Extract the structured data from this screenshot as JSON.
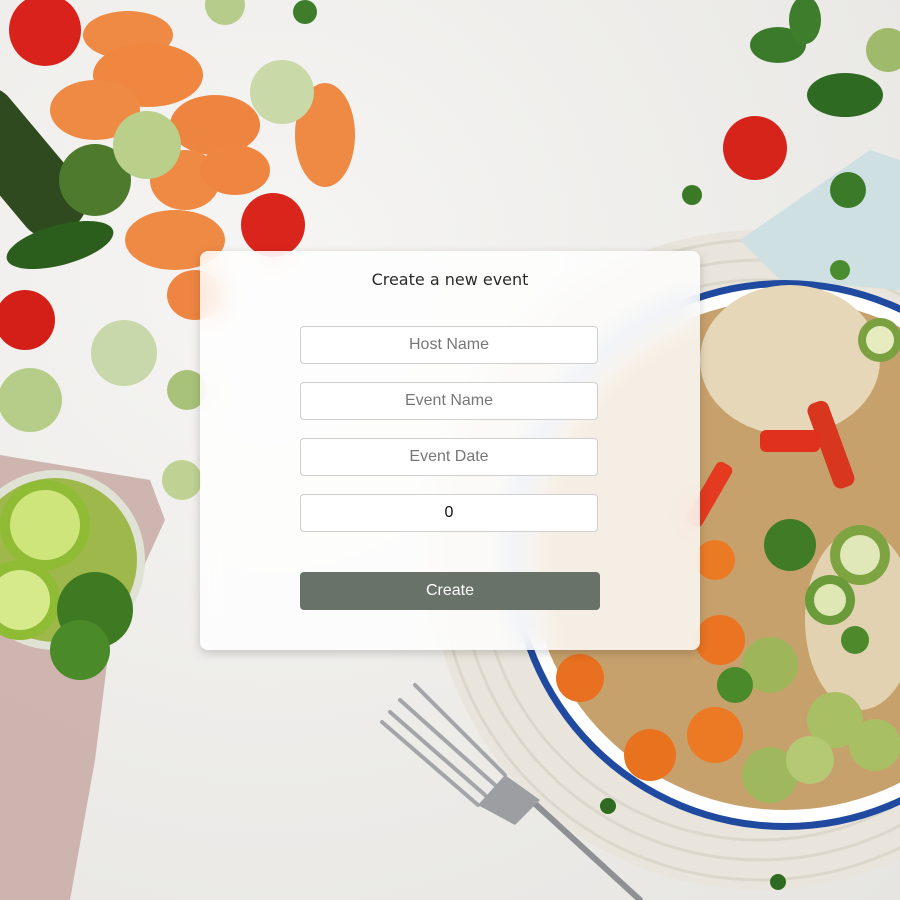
{
  "form": {
    "title": "Create a new event",
    "host_name_placeholder": "Host Name",
    "event_name_placeholder": "Event Name",
    "event_date_placeholder": "Event Date",
    "guest_count_value": "0",
    "create_label": "Create"
  },
  "colors": {
    "button_bg": "#687269",
    "card_bg": "#ffffff",
    "background": "#efeeec"
  }
}
